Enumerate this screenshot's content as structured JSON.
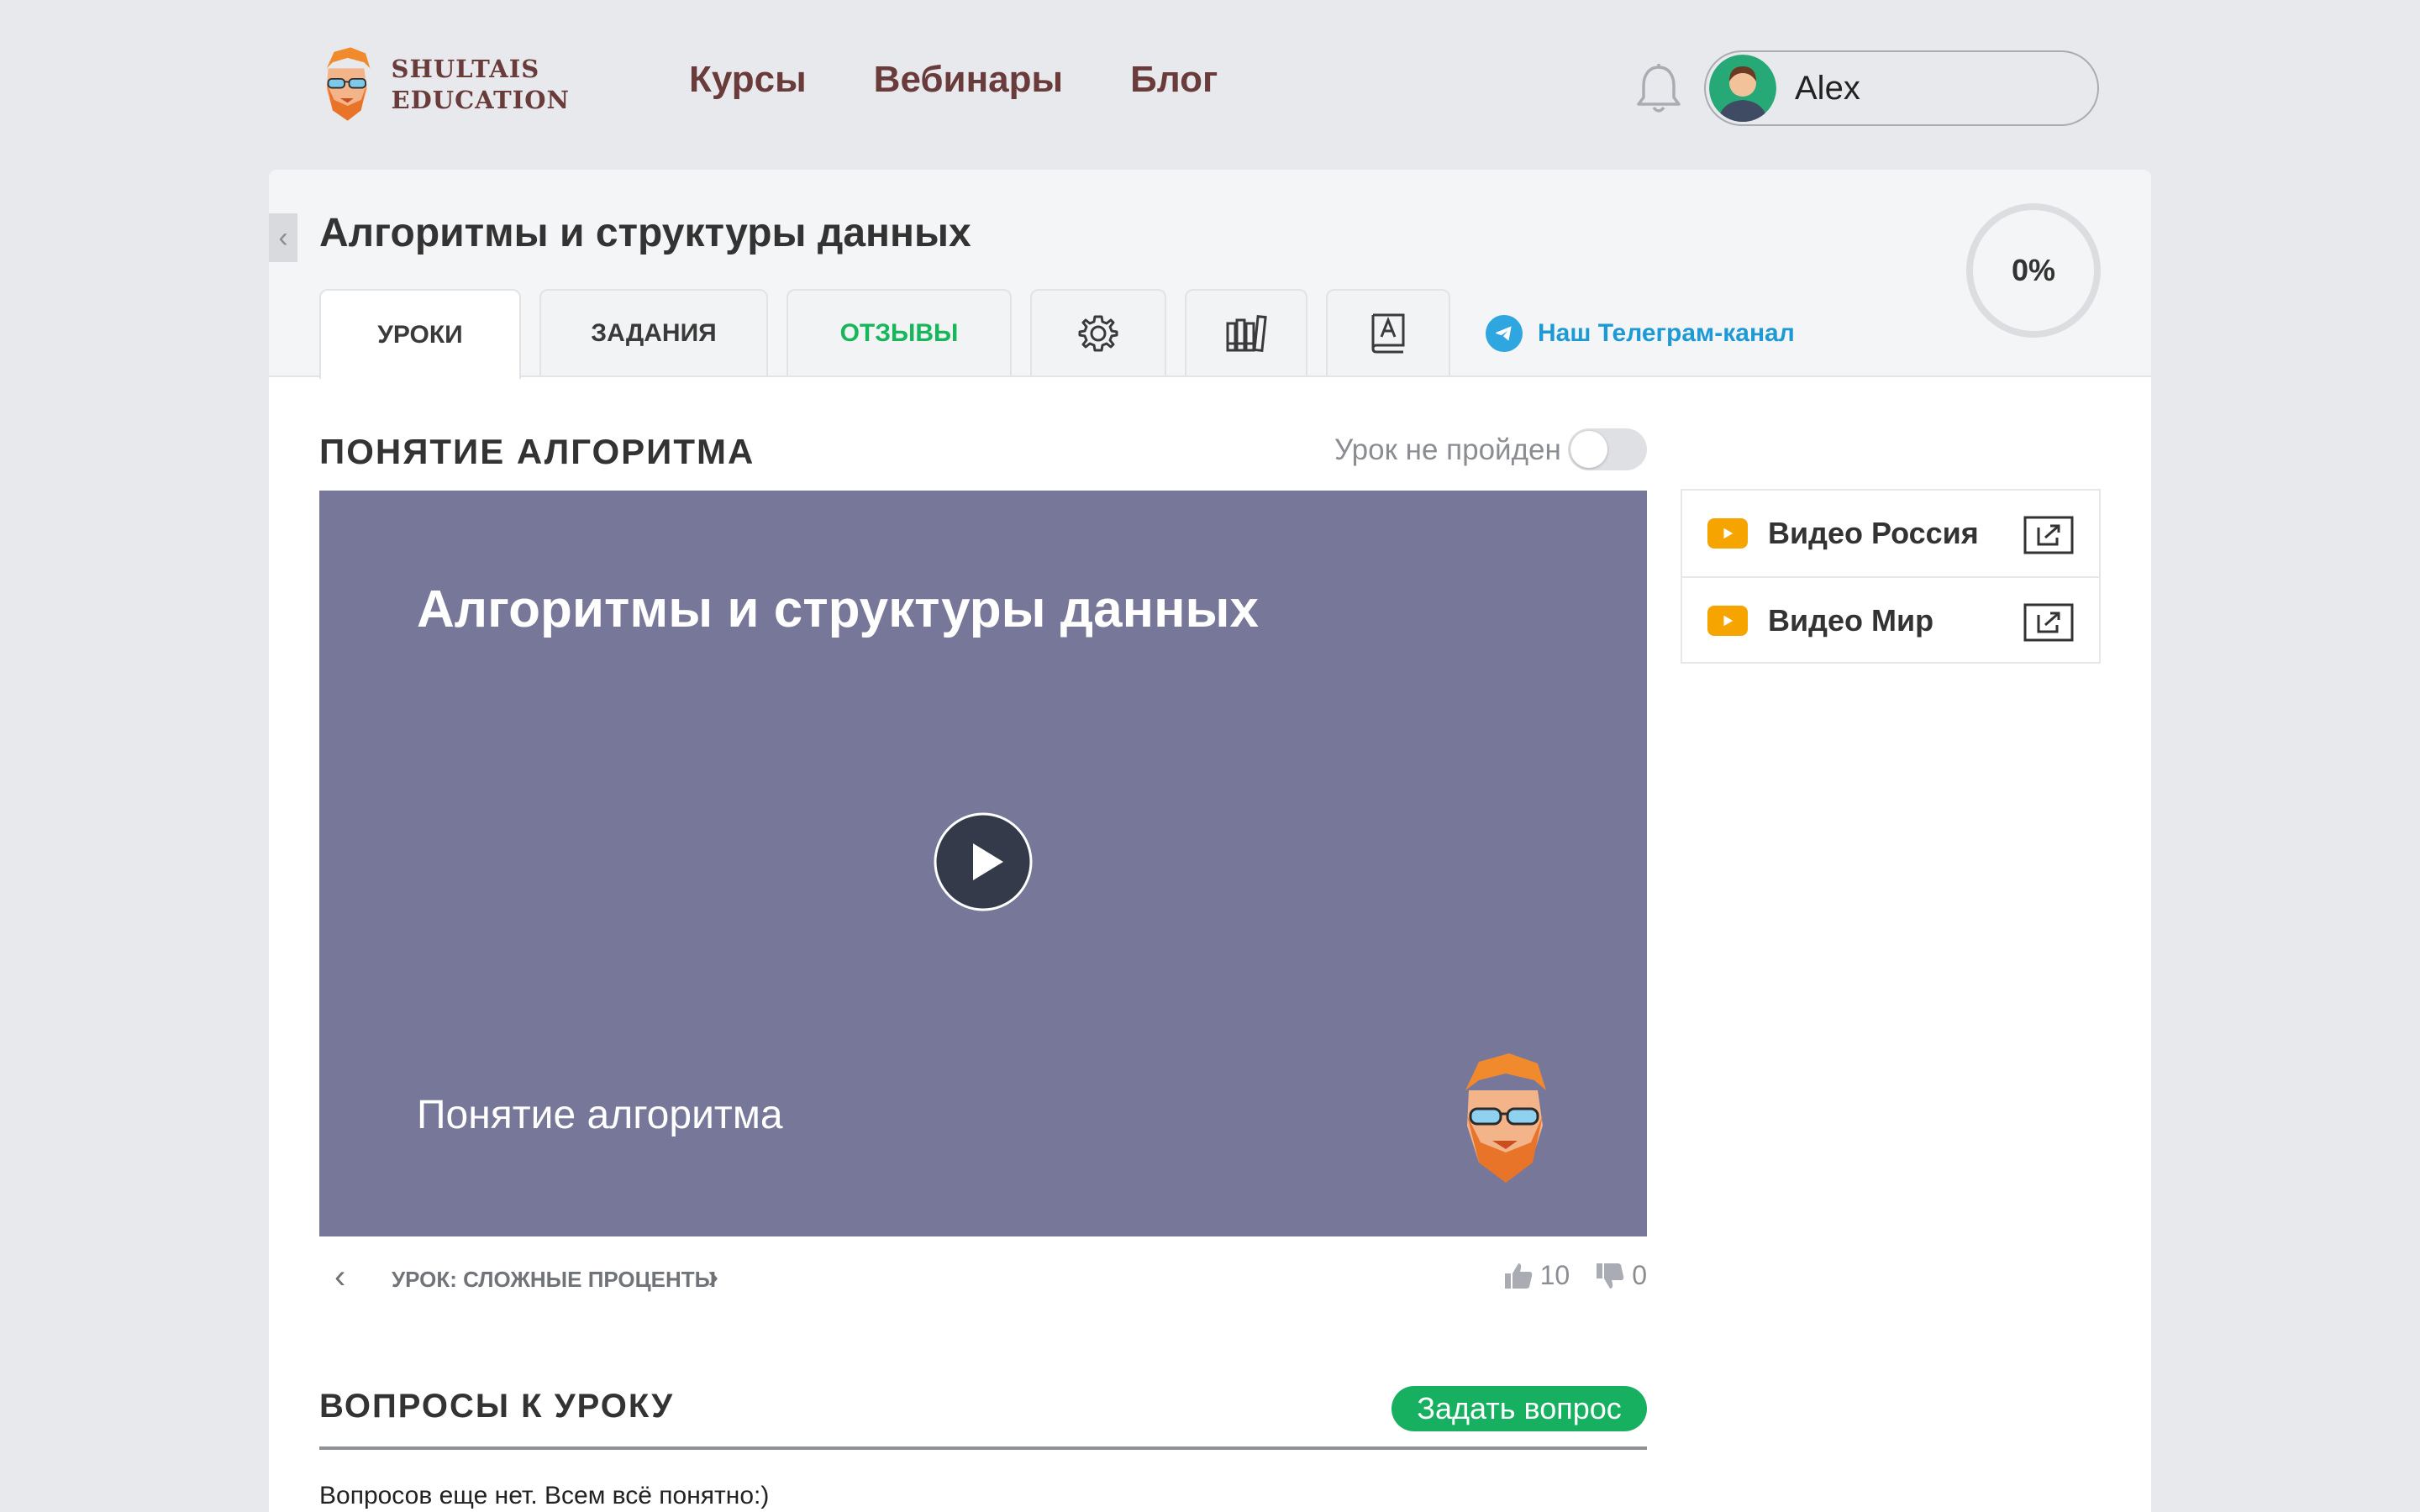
{
  "brand": {
    "line1": "SHULTAIS",
    "line2": "EDUCATION"
  },
  "nav": {
    "courses": "Курсы",
    "webinars": "Вебинары",
    "blog": "Блог"
  },
  "user": {
    "name": "Alex"
  },
  "course": {
    "title": "Алгоритмы и структуры данных",
    "progress": "0%",
    "progress_value": 0
  },
  "tabs": {
    "lessons": "УРОКИ",
    "tasks": "ЗАДАНИЯ",
    "reviews": "ОТЗЫВЫ",
    "telegram": "Наш Телеграм-канал"
  },
  "lesson": {
    "title": "ПОНЯТИЕ АЛГОРИТМА",
    "status": "Урок не пройден",
    "completed": false,
    "video_title": "Алгоритмы и структуры данных",
    "video_subtitle": "Понятие алгоритма",
    "next_lesson": "УРОК: СЛОЖНЫЕ ПРОЦЕНТЫ",
    "likes": "10",
    "dislikes": "0"
  },
  "video_links": [
    {
      "label": "Видео Россия"
    },
    {
      "label": "Видео Мир"
    }
  ],
  "questions": {
    "title": "ВОПРОСЫ К УРОКУ",
    "ask_button": "Задать вопрос",
    "empty_text": "Вопросов еще нет. Всем всё понятно:)"
  },
  "colors": {
    "brand_text": "#6a3b3b",
    "accent_green": "#16b65a",
    "telegram_blue": "#1d9ad6",
    "video_bg": "#777899",
    "youtube_orange": "#f6a400"
  },
  "icons": {
    "logo": "bearded-man-logo",
    "bell": "bell-icon",
    "settings": "gear-icon",
    "library": "books-icon",
    "dictionary": "dictionary-icon",
    "telegram": "telegram-icon",
    "play": "play-icon",
    "external": "external-link-icon",
    "like": "thumb-up-icon",
    "dislike": "thumb-down-icon"
  }
}
